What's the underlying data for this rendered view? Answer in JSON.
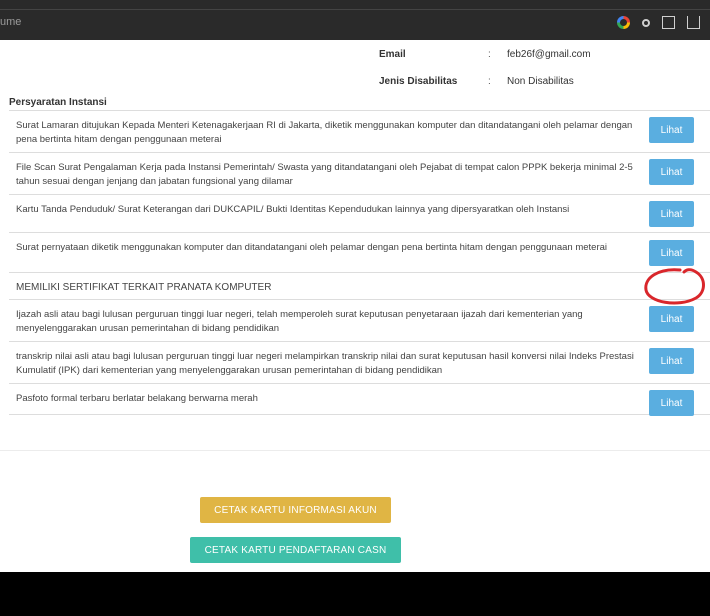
{
  "browser": {
    "url_text": "ume",
    "icons": [
      "google-icon",
      "key-icon",
      "translate-icon",
      "share-icon"
    ]
  },
  "profile": {
    "email_label": "Email",
    "email_colon": ":",
    "email_value": "feb26f@gmail.com",
    "disability_label": "Jenis Disabilitas",
    "disability_colon": ":",
    "disability_value": "Non Disabilitas"
  },
  "section": {
    "title": "Persyaratan Instansi"
  },
  "requirements": [
    {
      "text": "Surat Lamaran ditujukan Kepada Menteri Ketenagakerjaan RI di Jakarta, diketik menggunakan komputer dan ditandatangani oleh pelamar dengan pena bertinta hitam dengan penggunaan meterai",
      "button": "Lihat"
    },
    {
      "text": "File Scan Surat Pengalaman Kerja pada Instansi Pemerintah/ Swasta yang ditandatangani oleh Pejabat di tempat calon PPPK bekerja minimal 2-5 tahun sesuai dengan jenjang dan jabatan fungsional yang dilamar",
      "button": "Lihat"
    },
    {
      "text": "Kartu Tanda Penduduk/ Surat Keterangan dari DUKCAPIL/ Bukti Identitas Kependudukan lainnya yang dipersyaratkan oleh Instansi",
      "button": "Lihat"
    },
    {
      "text": "Surat pernyataan diketik menggunakan komputer dan ditandatangani oleh pelamar dengan pena bertinta hitam dengan penggunaan meterai",
      "button": "Lihat"
    },
    {
      "text": "MEMILIKI SERTIFIKAT TERKAIT PRANATA KOMPUTER",
      "button": ""
    },
    {
      "text": "Ijazah asli atau bagi lulusan perguruan tinggi luar negeri, telah memperoleh surat keputusan penyetaraan ijazah dari kementerian yang menyelenggarakan urusan pemerintahan di bidang pendidikan",
      "button": "Lihat"
    },
    {
      "text": "transkrip nilai asli atau bagi lulusan perguruan tinggi luar negeri melampirkan transkrip nilai dan surat keputusan hasil konversi nilai Indeks Prestasi Kumulatif (IPK) dari kementerian yang menyelenggarakan urusan pemerintahan di bidang pendidikan",
      "button": "Lihat"
    },
    {
      "text": "Pasfoto formal terbaru berlatar belakang berwarna merah",
      "button": "Lihat"
    }
  ],
  "actions": {
    "print_account_card": "CETAK KARTU INFORMASI AKUN",
    "print_registration_card": "CETAK KARTU PENDAFTARAN CASN"
  },
  "colors": {
    "lihat_button": "#5aaee0",
    "print_account_button": "#e0b544",
    "print_registration_button": "#3fbfa9",
    "annotation_circle": "#d9262b"
  }
}
